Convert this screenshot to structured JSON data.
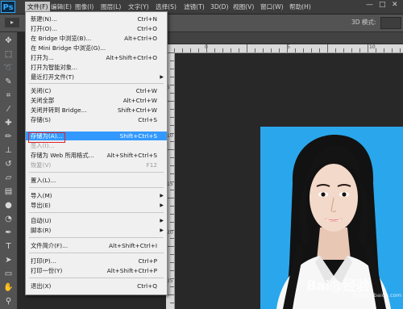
{
  "app": {
    "logo": "Ps",
    "menus": [
      "文件(F)",
      "编辑(E)",
      "图像(I)",
      "图层(L)",
      "文字(Y)",
      "选择(S)",
      "滤镜(T)",
      "3D(D)",
      "视图(V)",
      "窗口(W)",
      "帮助(H)"
    ],
    "window_controls": [
      "—",
      "□",
      "✕"
    ]
  },
  "options_bar": {
    "mode_label": "3D 模式:"
  },
  "file_menu": {
    "items": [
      {
        "label": "新建(N)...",
        "shortcut": "Ctrl+N"
      },
      {
        "label": "打开(O)...",
        "shortcut": "Ctrl+O"
      },
      {
        "label": "在 Bridge 中浏览(B)...",
        "shortcut": "Alt+Ctrl+O"
      },
      {
        "label": "在 Mini Bridge 中浏览(G)...",
        "shortcut": ""
      },
      {
        "label": "打开为...",
        "shortcut": "Alt+Shift+Ctrl+O"
      },
      {
        "label": "打开为智能对象...",
        "shortcut": ""
      },
      {
        "label": "最近打开文件(T)",
        "shortcut": "",
        "submenu": true
      },
      {
        "label": "关闭(C)",
        "shortcut": "Ctrl+W"
      },
      {
        "label": "关闭全部",
        "shortcut": "Alt+Ctrl+W"
      },
      {
        "label": "关闭并转到 Bridge...",
        "shortcut": "Shift+Ctrl+W"
      },
      {
        "label": "存储(S)",
        "shortcut": "Ctrl+S"
      },
      {
        "label": "存储为(A)...",
        "shortcut": "Shift+Ctrl+S",
        "highlighted": true
      },
      {
        "label": "签入(I)...",
        "shortcut": "",
        "disabled": true
      },
      {
        "label": "存储为 Web 所用格式...",
        "shortcut": "Alt+Shift+Ctrl+S"
      },
      {
        "label": "恢复(V)",
        "shortcut": "F12",
        "disabled": true
      },
      {
        "label": "置入(L)...",
        "shortcut": ""
      },
      {
        "label": "导入(M)",
        "shortcut": "",
        "submenu": true
      },
      {
        "label": "导出(E)",
        "shortcut": "",
        "submenu": true
      },
      {
        "label": "自动(U)",
        "shortcut": "",
        "submenu": true
      },
      {
        "label": "脚本(R)",
        "shortcut": "",
        "submenu": true
      },
      {
        "label": "文件简介(F)...",
        "shortcut": "Alt+Shift+Ctrl+I"
      },
      {
        "label": "打印(P)...",
        "shortcut": "Ctrl+P"
      },
      {
        "label": "打印一份(Y)",
        "shortcut": "Alt+Shift+Ctrl+P"
      },
      {
        "label": "退出(X)",
        "shortcut": "Ctrl+Q"
      }
    ]
  },
  "ruler": {
    "h_numbers": [
      "0",
      "5",
      "10"
    ],
    "v_numbers": [
      "5",
      "10",
      "15",
      "20",
      "25"
    ]
  },
  "watermark": {
    "text": "Bai@经验",
    "sub": "jingyan.baidu.com"
  },
  "colors": {
    "photo_background": "#2aa7ec",
    "menu_highlight": "#3399ff",
    "callout_border": "#e0202a"
  }
}
